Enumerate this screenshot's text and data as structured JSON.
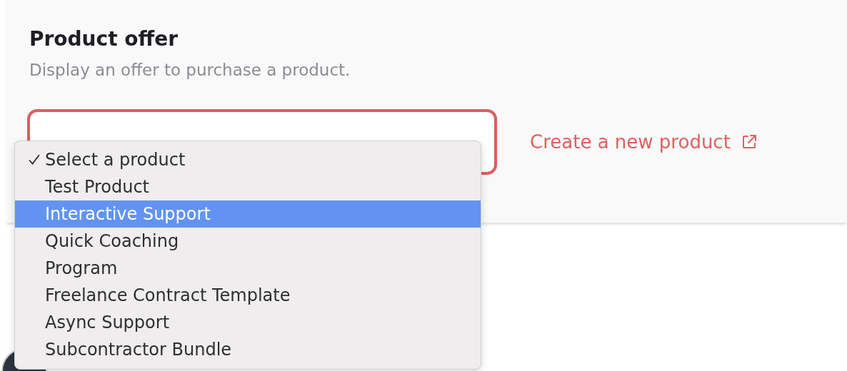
{
  "section": {
    "title": "Product offer",
    "description": "Display an offer to purchase a product."
  },
  "link": {
    "label": "Create a new product"
  },
  "dropdown": {
    "options": [
      {
        "label": "Select a product",
        "checked": true,
        "highlighted": false
      },
      {
        "label": "Test Product",
        "checked": false,
        "highlighted": false
      },
      {
        "label": "Interactive Support",
        "checked": false,
        "highlighted": true
      },
      {
        "label": "Quick Coaching",
        "checked": false,
        "highlighted": false
      },
      {
        "label": "Program",
        "checked": false,
        "highlighted": false
      },
      {
        "label": "Freelance Contract Template",
        "checked": false,
        "highlighted": false
      },
      {
        "label": "Async Support",
        "checked": false,
        "highlighted": false
      },
      {
        "label": "Subcontractor Bundle",
        "checked": false,
        "highlighted": false
      }
    ]
  }
}
